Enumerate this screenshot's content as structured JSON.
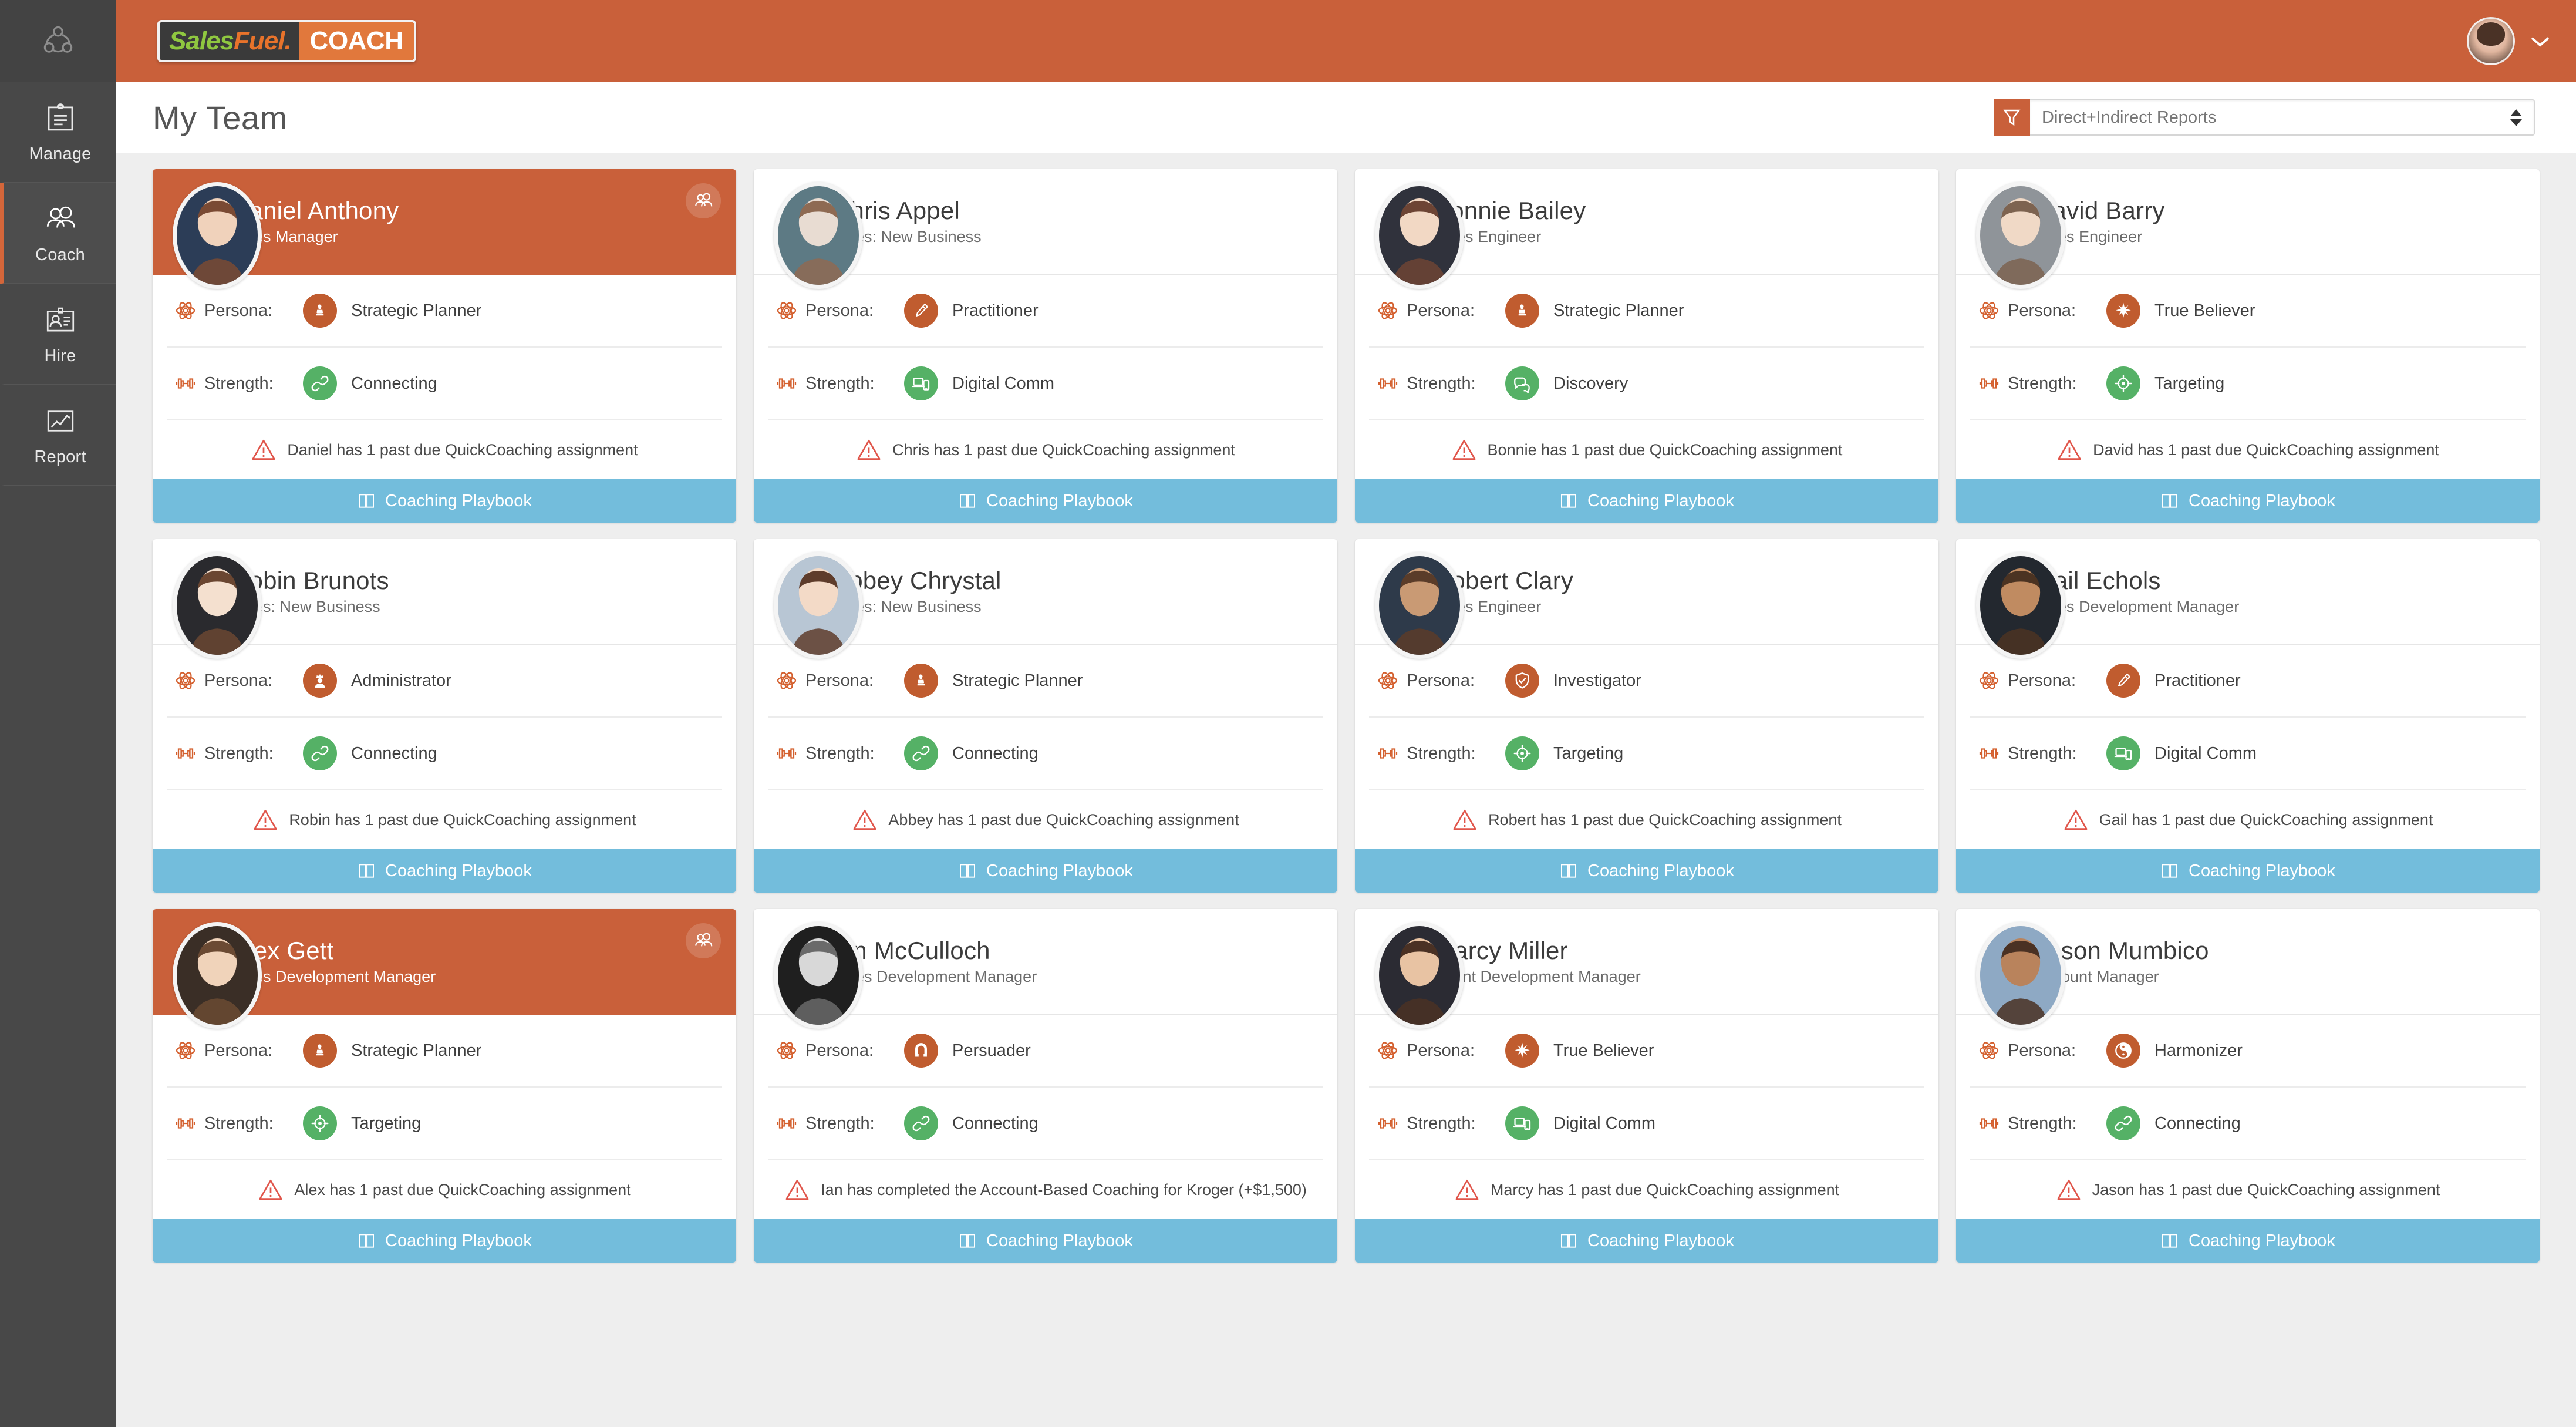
{
  "app": {
    "brand_left": "SalesFuel.",
    "brand_left_part1": "Sales",
    "brand_left_part2": "Fuel.",
    "brand_right": "COACH",
    "accent_orange": "#c9603a",
    "accent_blue": "#73bddc",
    "accent_green": "#55b166",
    "page_bg": "#eeeeee"
  },
  "sidebar": {
    "items": [
      {
        "label": "Manage",
        "icon": "clipboard-icon",
        "active": false
      },
      {
        "label": "Coach",
        "icon": "people-icon",
        "active": true
      },
      {
        "label": "Hire",
        "icon": "id-badge-icon",
        "active": false
      },
      {
        "label": "Report",
        "icon": "chart-icon",
        "active": false
      }
    ]
  },
  "header": {
    "title": "My Team",
    "filter_icon": "funnel-icon",
    "filter_value": "Direct+Indirect Reports",
    "user_avatar": "avatar",
    "user_chevron": "chevron-down-icon"
  },
  "labels": {
    "persona": "Persona:",
    "strength": "Strength:",
    "playbook": "Coaching Playbook",
    "persona_icon": "atom-icon",
    "strength_icon": "dumbbell-icon",
    "playbook_icon": "book-icon",
    "alert_icon": "warning-triangle-icon",
    "team_icon": "people-icon"
  },
  "cards": [
    {
      "name": "Daniel Anthony",
      "role": "Sales Manager",
      "persona": "Strategic Planner",
      "persona_icon": "chess-piece-icon",
      "strength": "Connecting",
      "strength_icon": "link-icon",
      "alert": "Daniel has 1 past due QuickCoaching assignment",
      "highlighted": true,
      "has_team_badge": true
    },
    {
      "name": "Chris Appel",
      "role": "Sales: New Business",
      "persona": "Practitioner",
      "persona_icon": "pen-icon",
      "strength": "Digital Comm",
      "strength_icon": "devices-icon",
      "alert": "Chris has 1 past due QuickCoaching assignment",
      "highlighted": false,
      "has_team_badge": false
    },
    {
      "name": "Bonnie Bailey",
      "role": "Sales Engineer",
      "persona": "Strategic Planner",
      "persona_icon": "chess-piece-icon",
      "strength": "Discovery",
      "strength_icon": "speech-bubbles-icon",
      "alert": "Bonnie has 1 past due QuickCoaching assignment",
      "highlighted": false,
      "has_team_badge": false
    },
    {
      "name": "David Barry",
      "role": "Sales Engineer",
      "persona": "True Believer",
      "persona_icon": "starburst-icon",
      "strength": "Targeting",
      "strength_icon": "crosshair-icon",
      "alert": "David has 1 past due QuickCoaching assignment",
      "highlighted": false,
      "has_team_badge": false
    },
    {
      "name": "Robin Brunots",
      "role": "Sales: New Business",
      "persona": "Administrator",
      "persona_icon": "crowned-person-icon",
      "strength": "Connecting",
      "strength_icon": "link-icon",
      "alert": "Robin has 1 past due QuickCoaching assignment",
      "highlighted": false,
      "has_team_badge": false
    },
    {
      "name": "Abbey Chrystal",
      "role": "Sales: New Business",
      "persona": "Strategic Planner",
      "persona_icon": "chess-piece-icon",
      "strength": "Connecting",
      "strength_icon": "link-icon",
      "alert": "Abbey has 1 past due QuickCoaching assignment",
      "highlighted": false,
      "has_team_badge": false
    },
    {
      "name": "Robert Clary",
      "role": "Sales Engineer",
      "persona": "Investigator",
      "persona_icon": "shield-check-icon",
      "strength": "Targeting",
      "strength_icon": "crosshair-icon",
      "alert": "Robert has 1 past due QuickCoaching assignment",
      "highlighted": false,
      "has_team_badge": false
    },
    {
      "name": "Gail Echols",
      "role": "Sales Development Manager",
      "persona": "Practitioner",
      "persona_icon": "pen-icon",
      "strength": "Digital Comm",
      "strength_icon": "devices-icon",
      "alert": "Gail has 1 past due QuickCoaching assignment",
      "highlighted": false,
      "has_team_badge": false
    },
    {
      "name": "Alex Gett",
      "role": "Sales Development Manager",
      "persona": "Strategic Planner",
      "persona_icon": "chess-piece-icon",
      "strength": "Targeting",
      "strength_icon": "crosshair-icon",
      "alert": "Alex has 1 past due QuickCoaching assignment",
      "highlighted": true,
      "has_team_badge": true
    },
    {
      "name": "Ian McCulloch",
      "role": "Sales Development Manager",
      "persona": "Persuader",
      "persona_icon": "magnet-icon",
      "strength": "Connecting",
      "strength_icon": "link-icon",
      "alert": "Ian has completed the Account-Based Coaching for Kroger (+$1,500)",
      "highlighted": false,
      "has_team_badge": false
    },
    {
      "name": "Marcy Miller",
      "role": "Talent Development Manager",
      "persona": "True Believer",
      "persona_icon": "starburst-icon",
      "strength": "Digital Comm",
      "strength_icon": "devices-icon",
      "alert": "Marcy has 1 past due QuickCoaching assignment",
      "highlighted": false,
      "has_team_badge": false
    },
    {
      "name": "Jason Mumbico",
      "role": "Account Manager",
      "persona": "Harmonizer",
      "persona_icon": "yin-yang-icon",
      "strength": "Connecting",
      "strength_icon": "link-icon",
      "alert": "Jason has 1 past due QuickCoaching assignment",
      "highlighted": false,
      "has_team_badge": false
    }
  ]
}
